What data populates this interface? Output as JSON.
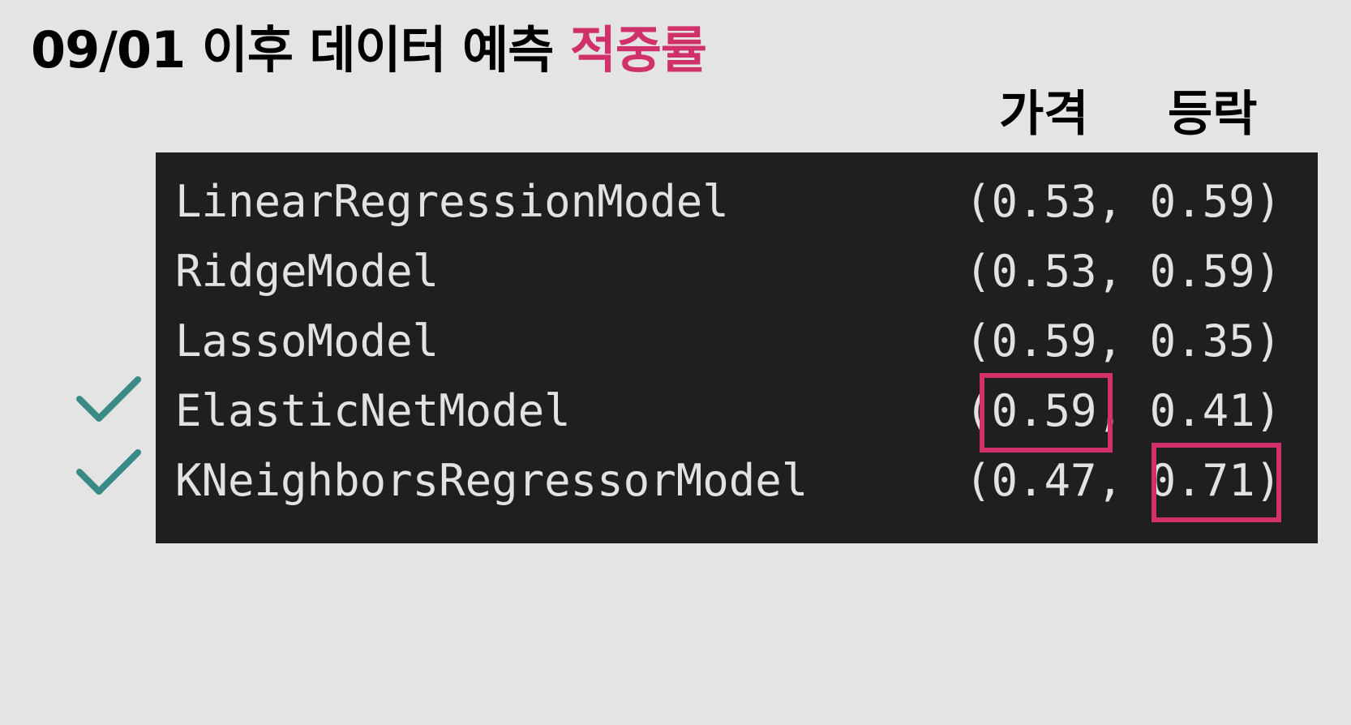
{
  "slide": {
    "title_main": "09/01 이후 데이터 예측 ",
    "title_accent": "적중률",
    "accent_color": "#d0316a",
    "check_color": "#3a8a88",
    "background": "#e4e4e4",
    "panel_background": "#1f1f1f"
  },
  "headers": {
    "price": "가격",
    "change": "등락"
  },
  "rows": [
    {
      "model": "LinearRegressionModel",
      "values": "(0.53, 0.59)",
      "checked": false
    },
    {
      "model": "RidgeModel",
      "values": "(0.53, 0.59)",
      "checked": false
    },
    {
      "model": "LassoModel",
      "values": "(0.59, 0.35)",
      "checked": false
    },
    {
      "model": "ElasticNetModel",
      "values": "(0.59, 0.41)",
      "checked": true,
      "highlight": "price"
    },
    {
      "model": "KNeighborsRegressorModel",
      "values": "(0.47, 0.71)",
      "checked": true,
      "highlight": "change"
    }
  ],
  "icons": {
    "check": "checkmark-icon"
  }
}
